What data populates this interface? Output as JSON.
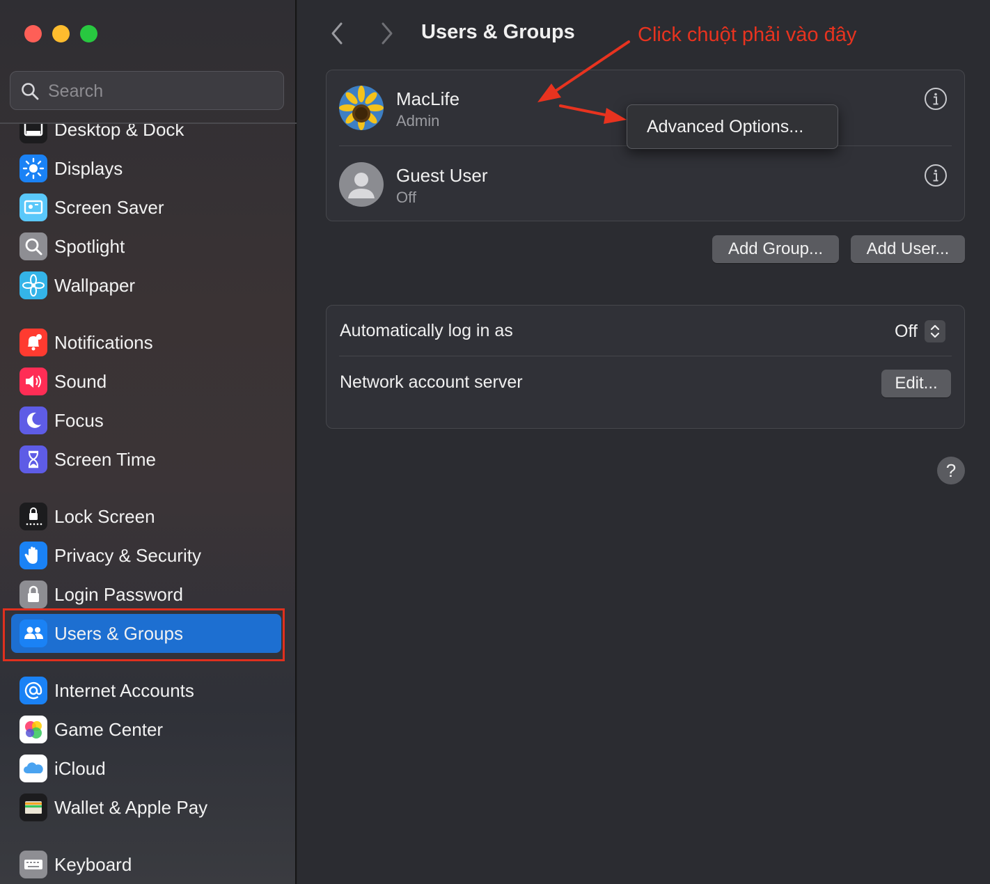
{
  "window": {
    "title": "Users & Groups"
  },
  "search": {
    "placeholder": "Search",
    "value": ""
  },
  "sidebar": {
    "items": [
      {
        "label": "Desktop & Dock",
        "icon": "dock-icon",
        "color": "#1c1c1e"
      },
      {
        "label": "Displays",
        "icon": "sun-icon",
        "color": "#1a82f5"
      },
      {
        "label": "Screen Saver",
        "icon": "screen-saver-icon",
        "color": "#5ac8fa"
      },
      {
        "label": "Spotlight",
        "icon": "magnifier-icon",
        "color": "#8e8e93"
      },
      {
        "label": "Wallpaper",
        "icon": "flower-icon",
        "color": "#34b4e8"
      },
      {
        "label": "Notifications",
        "icon": "bell-icon",
        "color": "#ff3b30"
      },
      {
        "label": "Sound",
        "icon": "speaker-icon",
        "color": "#ff2d55"
      },
      {
        "label": "Focus",
        "icon": "moon-icon",
        "color": "#5e5ce6"
      },
      {
        "label": "Screen Time",
        "icon": "hourglass-icon",
        "color": "#5e5ce6"
      },
      {
        "label": "Lock Screen",
        "icon": "lock-screen-icon",
        "color": "#1c1c1e"
      },
      {
        "label": "Privacy & Security",
        "icon": "hand-icon",
        "color": "#1a82f5"
      },
      {
        "label": "Login Password",
        "icon": "padlock-icon",
        "color": "#8e8e93"
      },
      {
        "label": "Users & Groups",
        "icon": "users-icon",
        "color": "#1a82f5",
        "selected": true
      },
      {
        "label": "Internet Accounts",
        "icon": "at-icon",
        "color": "#1a82f5"
      },
      {
        "label": "Game Center",
        "icon": "game-center-icon",
        "color": "#ffffff"
      },
      {
        "label": "iCloud",
        "icon": "cloud-icon",
        "color": "#ffffff"
      },
      {
        "label": "Wallet & Apple Pay",
        "icon": "wallet-icon",
        "color": "#1c1c1e"
      },
      {
        "label": "Keyboard",
        "icon": "keyboard-icon",
        "color": "#8e8e93"
      }
    ]
  },
  "main": {
    "title": "Users & Groups",
    "annotation": "Click chuột phải vào đây",
    "users": [
      {
        "name": "MacLife",
        "role": "Admin",
        "avatar": "sunflower-avatar"
      },
      {
        "name": "Guest User",
        "role": "Off",
        "avatar": "person-avatar"
      }
    ],
    "context_menu": {
      "item": "Advanced Options..."
    },
    "buttons": {
      "add_group": "Add Group...",
      "add_user": "Add User..."
    },
    "settings": {
      "auto_login_label": "Automatically log in as",
      "auto_login_value": "Off",
      "network_label": "Network account server",
      "edit_button": "Edit..."
    },
    "help": "?"
  },
  "colors": {
    "accent": "#1d6fd1",
    "annotation": "#e8331f",
    "highlight_outline": "#e0301e"
  }
}
